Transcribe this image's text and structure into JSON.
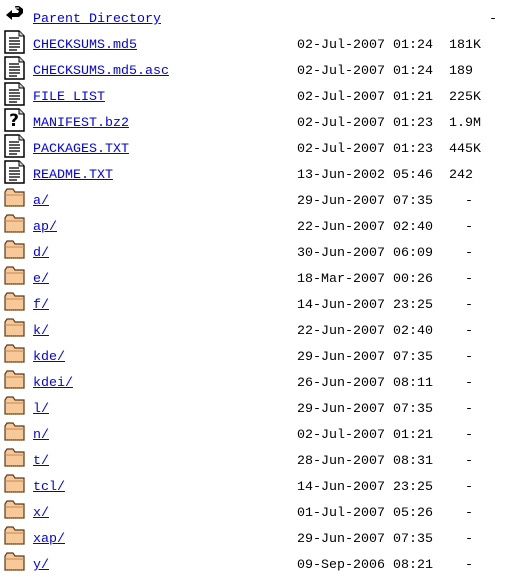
{
  "listing": {
    "entries": [
      {
        "name": "Parent Directory",
        "date": "",
        "size": "     -",
        "icon": "back-icon"
      },
      {
        "name": "CHECKSUMS.md5",
        "date": "02-Jul-2007 01:24",
        "size": "181K",
        "icon": "text-file-icon"
      },
      {
        "name": "CHECKSUMS.md5.asc",
        "date": "02-Jul-2007 01:24",
        "size": "189",
        "icon": "text-file-icon"
      },
      {
        "name": "FILE_LIST",
        "date": "02-Jul-2007 01:21",
        "size": "225K",
        "icon": "text-file-icon"
      },
      {
        "name": "MANIFEST.bz2",
        "date": "02-Jul-2007 01:23",
        "size": "1.9M",
        "icon": "unknown-file-icon"
      },
      {
        "name": "PACKAGES.TXT",
        "date": "02-Jul-2007 01:23",
        "size": "445K",
        "icon": "text-file-icon"
      },
      {
        "name": "README.TXT",
        "date": "13-Jun-2002 05:46",
        "size": "242",
        "icon": "text-file-icon"
      },
      {
        "name": "a/",
        "date": "29-Jun-2007 07:35",
        "size": "  -",
        "icon": "folder-icon"
      },
      {
        "name": "ap/",
        "date": "22-Jun-2007 02:40",
        "size": "  -",
        "icon": "folder-icon"
      },
      {
        "name": "d/",
        "date": "30-Jun-2007 06:09",
        "size": "  -",
        "icon": "folder-icon"
      },
      {
        "name": "e/",
        "date": "18-Mar-2007 00:26",
        "size": "  -",
        "icon": "folder-icon"
      },
      {
        "name": "f/",
        "date": "14-Jun-2007 23:25",
        "size": "  -",
        "icon": "folder-icon"
      },
      {
        "name": "k/",
        "date": "22-Jun-2007 02:40",
        "size": "  -",
        "icon": "folder-icon"
      },
      {
        "name": "kde/",
        "date": "29-Jun-2007 07:35",
        "size": "  -",
        "icon": "folder-icon"
      },
      {
        "name": "kdei/",
        "date": "26-Jun-2007 08:11",
        "size": "  -",
        "icon": "folder-icon"
      },
      {
        "name": "l/",
        "date": "29-Jun-2007 07:35",
        "size": "  -",
        "icon": "folder-icon"
      },
      {
        "name": "n/",
        "date": "02-Jul-2007 01:21",
        "size": "  -",
        "icon": "folder-icon"
      },
      {
        "name": "t/",
        "date": "28-Jun-2007 08:31",
        "size": "  -",
        "icon": "folder-icon"
      },
      {
        "name": "tcl/",
        "date": "14-Jun-2007 23:25",
        "size": "  -",
        "icon": "folder-icon"
      },
      {
        "name": "x/",
        "date": "01-Jul-2007 05:26",
        "size": "  -",
        "icon": "folder-icon"
      },
      {
        "name": "xap/",
        "date": "29-Jun-2007 07:35",
        "size": "  -",
        "icon": "folder-icon"
      },
      {
        "name": "y/",
        "date": "09-Sep-2006 08:21",
        "size": "  -",
        "icon": "folder-icon"
      }
    ]
  },
  "colors": {
    "link": "#0000ee",
    "folder": "#f7c898"
  }
}
